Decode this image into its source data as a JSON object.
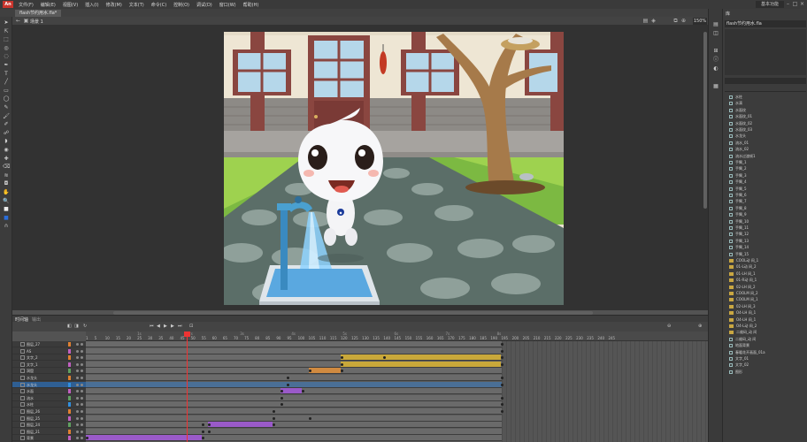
{
  "app": {
    "logo": "An",
    "workspace": "基本功能"
  },
  "menu": [
    "文件(F)",
    "编辑(E)",
    "视图(V)",
    "插入(I)",
    "修改(M)",
    "文本(T)",
    "命令(C)",
    "控制(O)",
    "调试(D)",
    "窗口(W)",
    "帮助(H)"
  ],
  "document": {
    "tab": "flash节约用水.fla*",
    "scene": "场景 1",
    "zoom": "150%"
  },
  "timeline": {
    "tabs": [
      "时间轴",
      "输出"
    ],
    "ruler_labels": [
      "1",
      "5",
      "10",
      "15",
      "20",
      "25",
      "30",
      "35",
      "40",
      "45",
      "50",
      "55",
      "60",
      "65",
      "70",
      "75",
      "80",
      "85",
      "90",
      "95",
      "100",
      "105",
      "110",
      "115",
      "120",
      "125",
      "130",
      "135",
      "140",
      "145",
      "150",
      "155",
      "160",
      "165",
      "170",
      "175",
      "180",
      "185",
      "190",
      "195",
      "200",
      "205",
      "210",
      "215",
      "220",
      "225",
      "230",
      "235",
      "240",
      "245"
    ],
    "seconds": [
      "1s",
      "2s",
      "3s",
      "4s",
      "5s",
      "6s",
      "7s",
      "8s"
    ],
    "playhead_frame": 48,
    "layers": [
      {
        "name": "图层_27",
        "color": "#e08030"
      },
      {
        "name": "AS",
        "color": "#c060c0"
      },
      {
        "name": "文字_2",
        "color": "#e08030"
      },
      {
        "name": "文字_1",
        "color": "#c060c0"
      },
      {
        "name": "洞窟",
        "color": "#60a060"
      },
      {
        "name": "水龙头",
        "color": "#e08030"
      },
      {
        "name": "水龙头",
        "color": "#3090e0"
      },
      {
        "name": "水面",
        "color": "#c060c0"
      },
      {
        "name": "流水",
        "color": "#60a060"
      },
      {
        "name": "水柱",
        "color": "#3090e0"
      },
      {
        "name": "图层_26",
        "color": "#e08030"
      },
      {
        "name": "图层_25",
        "color": "#c060c0"
      },
      {
        "name": "图层_24",
        "color": "#60a060"
      },
      {
        "name": "图层_21",
        "color": "#e08030"
      },
      {
        "name": "背景",
        "color": "#c060c0"
      }
    ]
  },
  "library": {
    "title": "库",
    "document": "flash节约用水.fla",
    "items": [
      "水柱",
      "水滴",
      "水面纹",
      "水面纹_01",
      "水面纹_02",
      "水面纹_03",
      "水龙头",
      "流水_01",
      "流水_02",
      "流水过渡帧1",
      "手臂_1",
      "手臂_2",
      "手臂_3",
      "手臂_4",
      "手臂_5",
      "手臂_6",
      "手臂_7",
      "手臂_8",
      "手臂_9",
      "手臂_10",
      "手臂_11",
      "手臂_12",
      "手臂_13",
      "手臂_14",
      "手臂_15",
      "COOL动 间_1",
      "01-L动 间_2",
      "01-LH 间_1",
      "01-R动 间_1",
      "02-LH 间_2",
      "COOLM 间_2",
      "COOLM 间_1",
      "02-LH 间_3",
      "O4-LH 间_1",
      "O4-LH 间_1",
      "O4-L动 间_2",
      "二维码_动 间",
      "二维码_动 间",
      "地面背景",
      "春暖花开画面_01a",
      "文字_01",
      "文字_02",
      "图形"
    ]
  },
  "stage": {
    "badge": "◆"
  },
  "icons": {
    "tools": [
      "selection-tool-icon",
      "subselection-tool-icon",
      "free-transform-icon",
      "3d-rotation-icon",
      "lasso-icon",
      "pen-icon",
      "text-icon",
      "line-icon",
      "rectangle-icon",
      "oval-icon",
      "pencil-icon",
      "brush-icon",
      "paint-brush-icon",
      "bone-icon",
      "paint-bucket-icon",
      "ink-bottle-icon",
      "eyedropper-icon",
      "eraser-icon",
      "width-tool-icon",
      "camera-icon",
      "hand-icon",
      "zoom-icon",
      "stroke-color-icon",
      "fill-color-icon",
      "snap-icon"
    ]
  }
}
